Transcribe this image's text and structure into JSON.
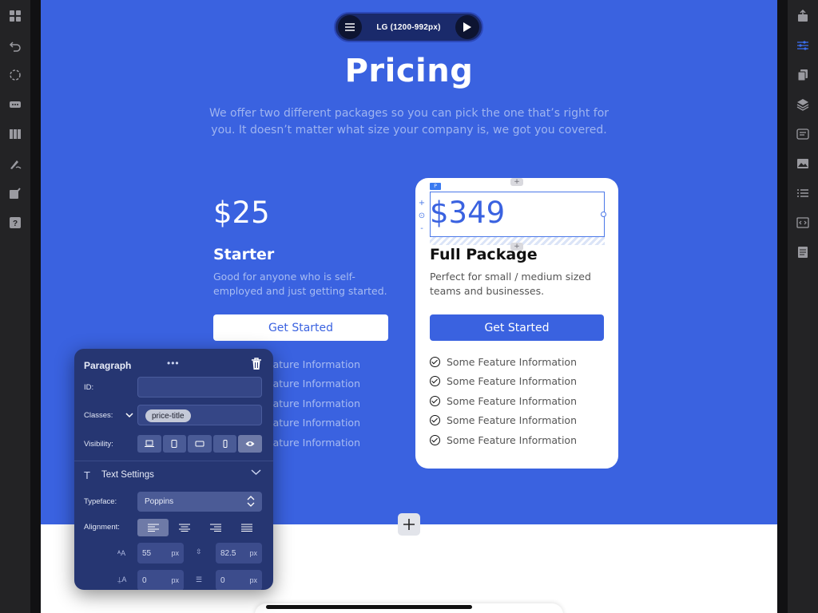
{
  "breakpoint": {
    "label": "LG (1200-992px)"
  },
  "hero": {
    "title": "Pricing",
    "subtitle": "We offer two different packages so you can pick the one that’s right for you. It doesn’t matter what size your company is, we got you covered."
  },
  "plans": [
    {
      "price": "$25",
      "name": "Starter",
      "description": "Good for anyone who is self-employed and just getting started.",
      "cta": "Get Started",
      "features": [
        "Some Feature Information",
        "Some Feature Information",
        "Some Feature Information",
        "Some Feature Information",
        "Some Feature Information"
      ]
    },
    {
      "price": "$349",
      "name": "Full Package",
      "description": "Perfect for small / medium sized teams and businesses.",
      "cta": "Get Started",
      "features": [
        "Some Feature Information",
        "Some Feature Information",
        "Some Feature Information",
        "Some Feature Information",
        "Some Feature Information"
      ]
    }
  ],
  "selection": {
    "tag": "P"
  },
  "panel": {
    "title": "Paragraph",
    "more": "•••",
    "id_label": "ID:",
    "id_value": "",
    "classes_label": "Classes:",
    "class_chip": "price-title",
    "visibility_label": "Visibility:",
    "text_settings_label": "Text Settings",
    "typeface_label": "Typeface:",
    "typeface_value": "Poppins",
    "alignment_label": "Alignment:",
    "font_size": "55",
    "line_height": "82.5",
    "letter_spacing": "0",
    "word_spacing": "0",
    "unit": "px"
  },
  "colors": {
    "hero_bg": "#3a62e0",
    "accent": "#3a62e0",
    "panel_bg": "#263672"
  }
}
